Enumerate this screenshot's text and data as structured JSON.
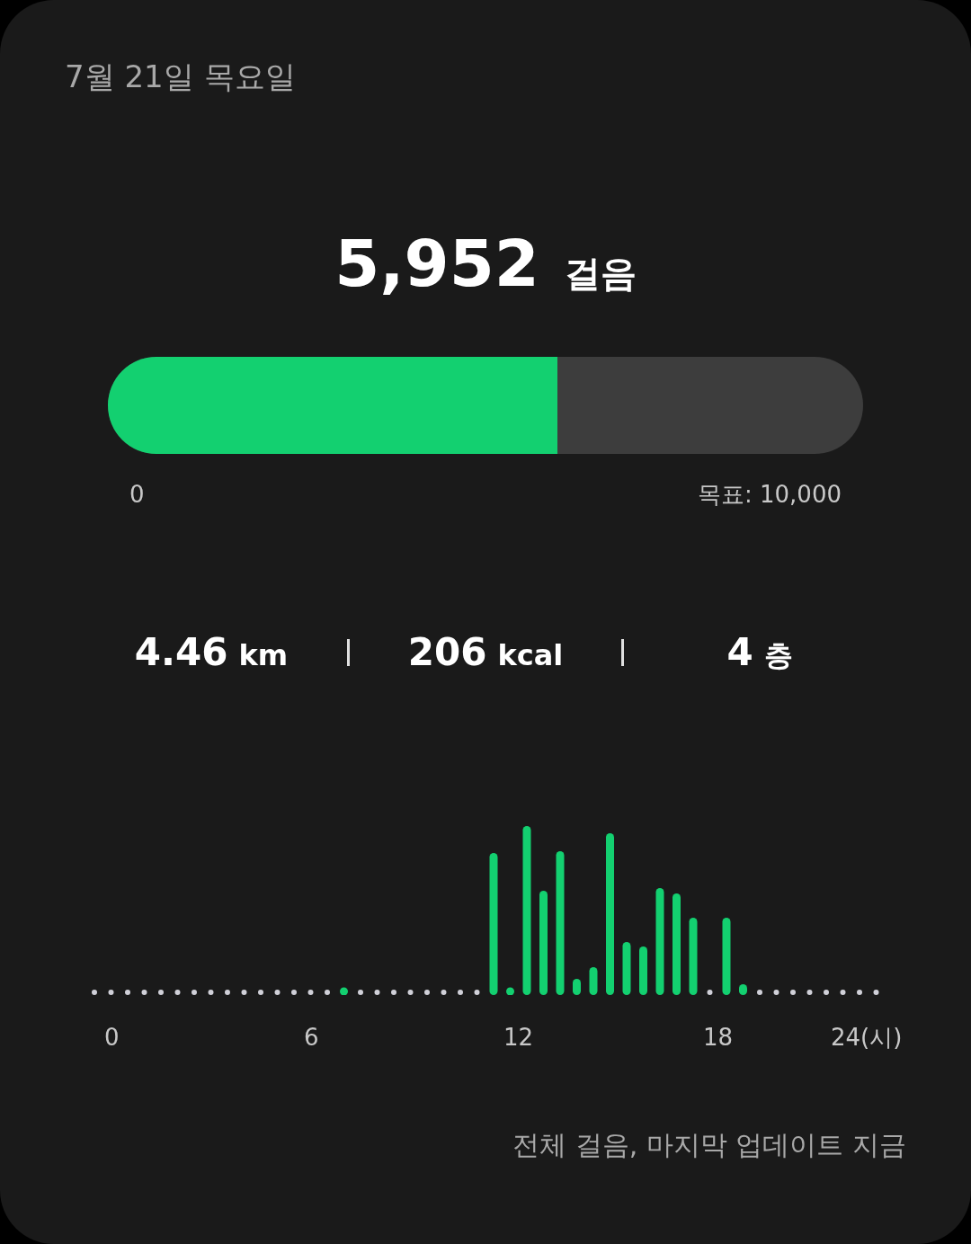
{
  "date": "7월 21일 목요일",
  "steps": {
    "value": "5,952",
    "unit": "걸음"
  },
  "goal_bar": {
    "level": 0.5952,
    "min_label": "0",
    "goal_label": "목표: 10,000"
  },
  "stats": [
    {
      "value": "4.46",
      "unit": "km"
    },
    {
      "value": "206",
      "unit": "kcal"
    },
    {
      "value": "4",
      "unit": "층"
    }
  ],
  "hourly_chart": {
    "kind": "picture",
    "x_labels": [
      "0",
      "6",
      "12",
      "18",
      "24(시)"
    ]
  },
  "footer": "전체 걸음, 마지막 업데이트 지금"
}
